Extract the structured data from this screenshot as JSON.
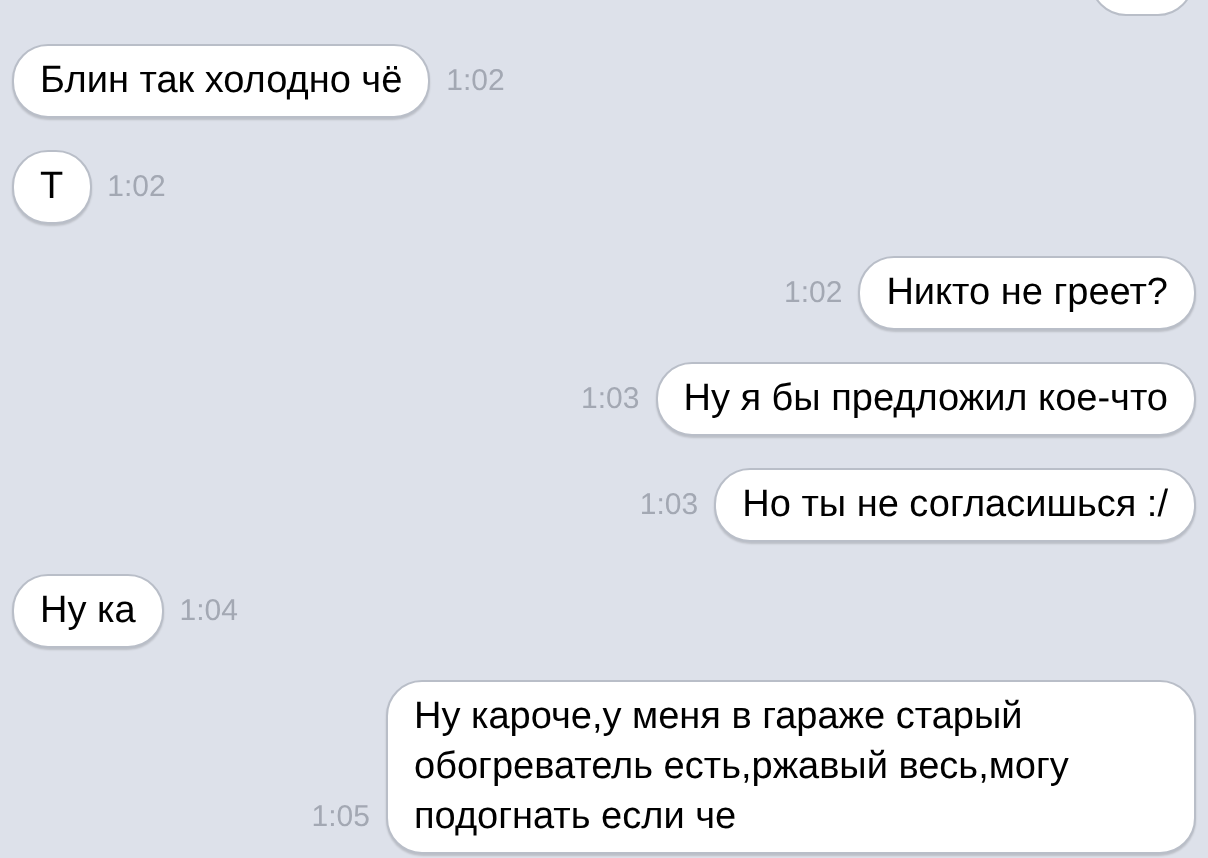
{
  "messages": [
    {
      "kind": "incoming",
      "text": "Блин так холодно чё",
      "time": "1:02"
    },
    {
      "kind": "incoming",
      "text": "Т",
      "time": "1:02"
    },
    {
      "kind": "outgoing",
      "text": "Никто не греет?",
      "time": "1:02"
    },
    {
      "kind": "outgoing",
      "text": "Ну я бы предложил кое-что",
      "time": "1:03"
    },
    {
      "kind": "outgoing",
      "text": "Но ты не согласишься :/",
      "time": "1:03"
    },
    {
      "kind": "incoming",
      "text": "Ну ка",
      "time": "1:04"
    },
    {
      "kind": "outgoing",
      "text": "Ну кароче,у меня в гараже старый обогреватель есть,ржавый весь,могу подогнать если че",
      "time": "1:05"
    }
  ]
}
